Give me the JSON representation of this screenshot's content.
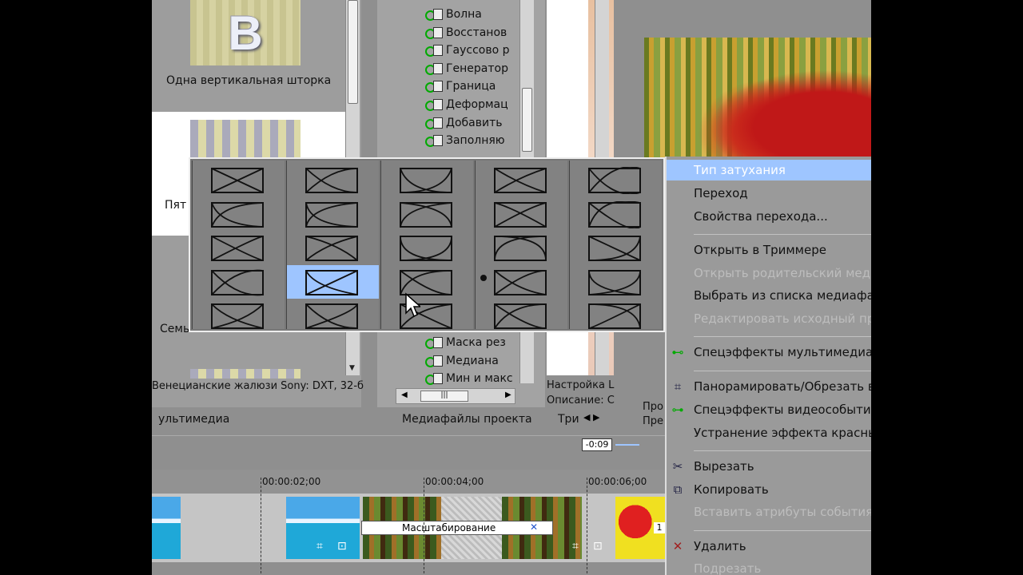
{
  "transitions": {
    "label_top": "Одна вертикальная шторка",
    "label_partial_1": "Пят",
    "label_partial_2": "Семь",
    "status": "Венецианские жалюзи Sony: DXT, 32-б",
    "tab": "ультимедиа"
  },
  "media_tree": {
    "items_top": [
      "Волна",
      "Восстанов",
      "Гауссово р",
      "Генератор",
      "Граница",
      "Деформац",
      "Добавить",
      "Заполняю"
    ],
    "items_bottom": [
      "Маска рез",
      "Медиана",
      "Мин и макс"
    ],
    "tab": "Медиафайлы проекта",
    "tab2": "Три"
  },
  "properties": {
    "line1": "Настройка L",
    "line2": "Описание: С",
    "side1": "Про",
    "side2": "Пре"
  },
  "context_menu": {
    "items": [
      {
        "label": "Тип затухания",
        "state": "highlight"
      },
      {
        "label": "Переход",
        "state": "normal"
      },
      {
        "label": "Свойства перехода...",
        "state": "normal"
      },
      {
        "label": "Открыть в Триммере",
        "state": "normal"
      },
      {
        "label": "Открыть родительский медиа",
        "state": "disabled"
      },
      {
        "label": "Выбрать из списка медиафай",
        "state": "normal"
      },
      {
        "label": "Редактировать исходный про",
        "state": "disabled"
      },
      {
        "label": "Спецэффекты мультимедиа...",
        "state": "normal",
        "icon": "media-fx-icon"
      },
      {
        "label": "Панорамировать/Обрезать в",
        "state": "normal",
        "icon": "crop-icon"
      },
      {
        "label": "Спецэффекты видеособытия...",
        "state": "normal",
        "icon": "event-fx-icon"
      },
      {
        "label": "Устранение эффекта красных",
        "state": "normal"
      },
      {
        "label": "Вырезать",
        "state": "normal",
        "icon": "scissors-icon"
      },
      {
        "label": "Копировать",
        "state": "normal",
        "icon": "copy-icon"
      },
      {
        "label": "Вставить атрибуты события",
        "state": "disabled"
      },
      {
        "label": "Удалить",
        "state": "normal",
        "icon": "delete-icon"
      },
      {
        "label": "Подрезать",
        "state": "disabled"
      }
    ]
  },
  "timeline": {
    "time_box": "-0:09",
    "ticks": [
      "00:00:02;00",
      "00:00:04;00",
      "00:00:06;00"
    ],
    "fx_label": "Масштабирование",
    "badge": "1"
  },
  "colors": {
    "highlight": "#9ec5ff",
    "disabled_text": "#bdbdbd",
    "fx_green": "#00a000"
  }
}
